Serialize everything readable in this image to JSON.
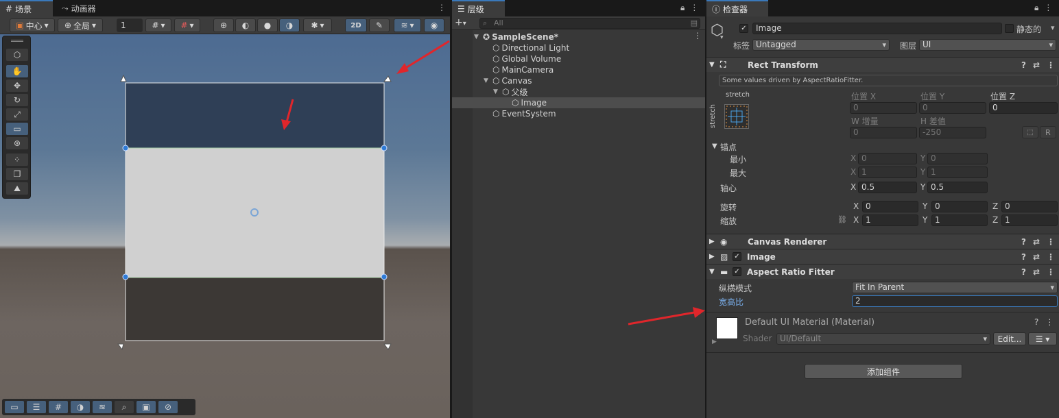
{
  "scene_panel": {
    "tabs": [
      {
        "label": "场景",
        "icon": "grid-icon"
      },
      {
        "label": "动画器",
        "icon": "animator-icon"
      }
    ],
    "toolbar": {
      "pivot_label": "中心",
      "handle_label": "全局",
      "grid_value": "1",
      "mode_2d": "2D"
    }
  },
  "hierarchy_panel": {
    "tab_label": "层级",
    "search_placeholder": "All",
    "items": [
      {
        "label": "SampleScene*",
        "depth": 0,
        "expanded": true,
        "bold": true
      },
      {
        "label": "Directional Light",
        "depth": 1
      },
      {
        "label": "Global Volume",
        "depth": 1
      },
      {
        "label": "MainCamera",
        "depth": 1
      },
      {
        "label": "Canvas",
        "depth": 1,
        "expanded": true
      },
      {
        "label": "父级",
        "depth": 2,
        "expanded": true
      },
      {
        "label": "Image",
        "depth": 3,
        "selected": true
      },
      {
        "label": "EventSystem",
        "depth": 1
      }
    ]
  },
  "inspector_panel": {
    "tab_label": "检查器",
    "object_name": "Image",
    "static_label": "静态的",
    "tag_label": "标签",
    "tag_value": "Untagged",
    "layer_label": "图层",
    "layer_value": "UI",
    "rect_transform": {
      "title": "Rect Transform",
      "info": "Some values driven by AspectRatioFitter.",
      "stretch_top": "stretch",
      "stretch_side": "stretch",
      "pos_x_label": "位置 X",
      "pos_x": "0",
      "pos_y_label": "位置 Y",
      "pos_y": "0",
      "pos_z_label": "位置 Z",
      "pos_z": "0",
      "w_label": "W 增量",
      "w": "0",
      "h_label": "H 差值",
      "h": "-250",
      "r_button": "R",
      "anchors_label": "锚点",
      "min_label": "最小",
      "min_x": "0",
      "min_y": "0",
      "max_label": "最大",
      "max_x": "1",
      "max_y": "1",
      "pivot_label": "轴心",
      "pivot_x": "0.5",
      "pivot_y": "0.5",
      "rotation_label": "旋转",
      "rot_x": "0",
      "rot_y": "0",
      "rot_z": "0",
      "scale_label": "缩放",
      "scale_x": "1",
      "scale_y": "1",
      "scale_z": "1",
      "x": "X",
      "y": "Y",
      "z": "Z"
    },
    "canvas_renderer_title": "Canvas Renderer",
    "image_title": "Image",
    "aspect_ratio_fitter": {
      "title": "Aspect Ratio Fitter",
      "mode_label": "纵横模式",
      "mode_value": "Fit In Parent",
      "ratio_label": "宽高比",
      "ratio_value": "2"
    },
    "material": {
      "title": "Default UI Material (Material)",
      "shader_label": "Shader",
      "shader_value": "UI/Default",
      "edit_button": "Edit..."
    },
    "add_component_button": "添加组件"
  },
  "colors": {
    "accent": "#3a79bb",
    "annotation_arrow": "#e0262b",
    "field_label_blue": "#7ab0ee"
  }
}
